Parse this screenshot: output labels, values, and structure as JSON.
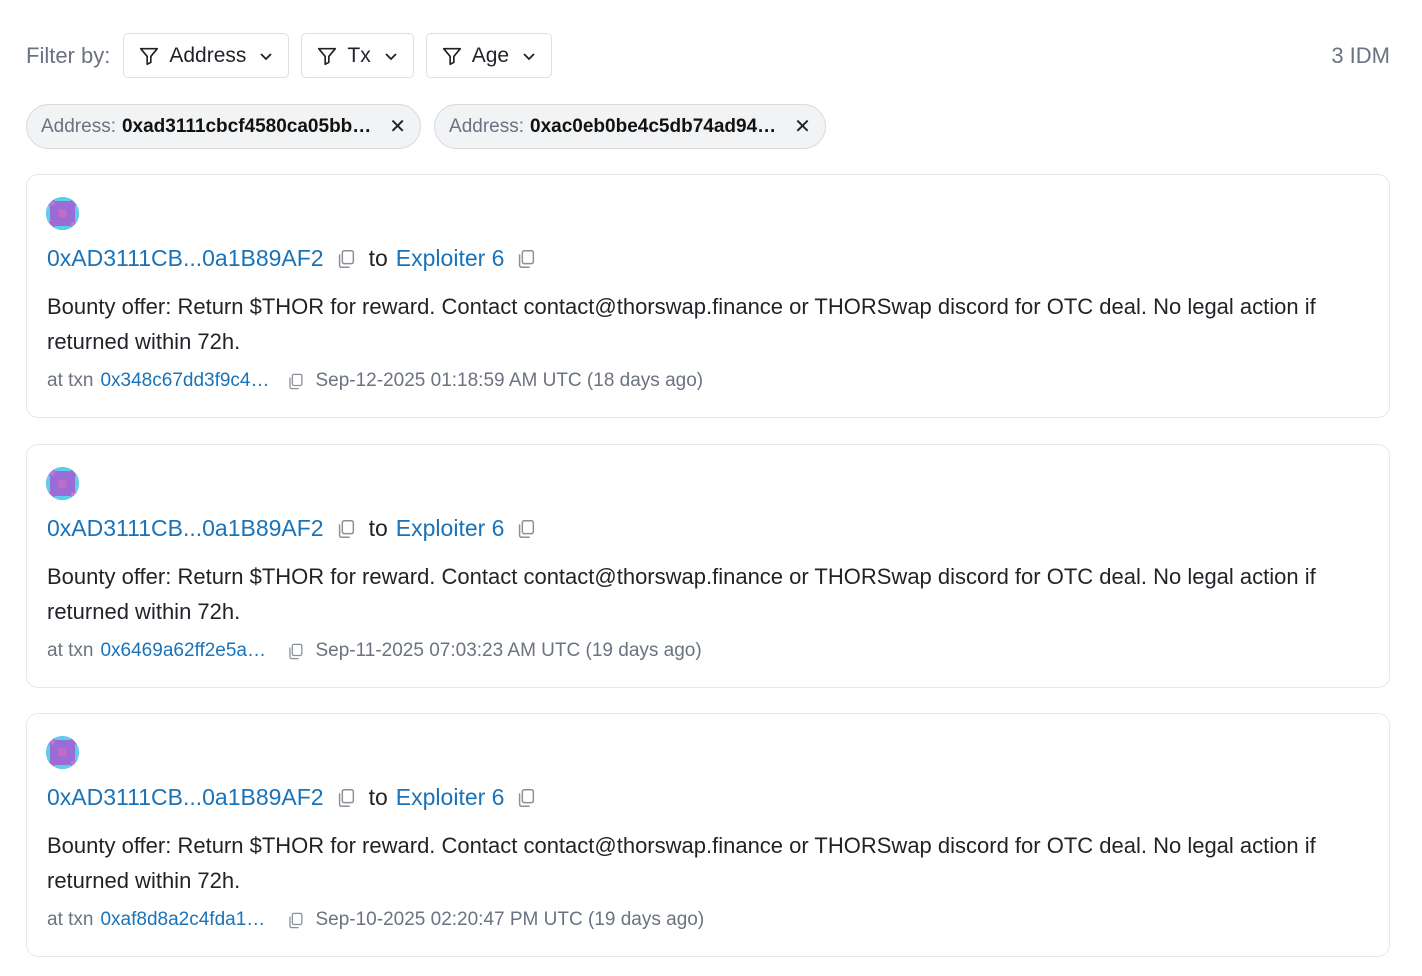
{
  "filters": {
    "label": "Filter by:",
    "buttons": [
      {
        "label": "Address"
      },
      {
        "label": "Tx"
      },
      {
        "label": "Age"
      }
    ],
    "count": "3 IDM"
  },
  "chips": [
    {
      "key": "Address:",
      "value": "0xad3111cbcf4580ca05bb…"
    },
    {
      "key": "Address:",
      "value": "0xac0eb0be4c5db74ad94…"
    }
  ],
  "messages": [
    {
      "from": "0xAD3111CB...0a1B89AF2",
      "to_word": "to",
      "to": "Exploiter 6",
      "text": "Bounty offer: Return $THOR for reward. Contact contact@thorswap.finance or THORSwap discord for OTC deal. No legal action if returned within 72h.",
      "at_txn": "at txn",
      "txn": "0x348c67dd3f9c4…",
      "time": "Sep-12-2025 01:18:59 AM UTC (18 days ago)"
    },
    {
      "from": "0xAD3111CB...0a1B89AF2",
      "to_word": "to",
      "to": "Exploiter 6",
      "text": "Bounty offer: Return $THOR for reward. Contact contact@thorswap.finance or THORSwap discord for OTC deal. No legal action if returned within 72h.",
      "at_txn": "at txn",
      "txn": "0x6469a62ff2e5a…",
      "time": "Sep-11-2025 07:03:23 AM UTC (19 days ago)"
    },
    {
      "from": "0xAD3111CB...0a1B89AF2",
      "to_word": "to",
      "to": "Exploiter 6",
      "text": "Bounty offer: Return $THOR for reward. Contact contact@thorswap.finance or THORSwap discord for OTC deal. No legal action if returned within 72h.",
      "at_txn": "at txn",
      "txn": "0xaf8d8a2c4fda1…",
      "time": "Sep-10-2025 02:20:47 PM UTC (19 days ago)"
    }
  ],
  "icons": {
    "filter": "filter-icon",
    "chevron": "chevron-down-icon",
    "copy": "copy-icon",
    "close": "close-icon",
    "avatar": "identicon-avatar"
  },
  "colors": {
    "link": "#1a73b8",
    "muted": "#6b7280",
    "avatar_a": "#9b6bd6",
    "avatar_b": "#5bd1e8"
  }
}
